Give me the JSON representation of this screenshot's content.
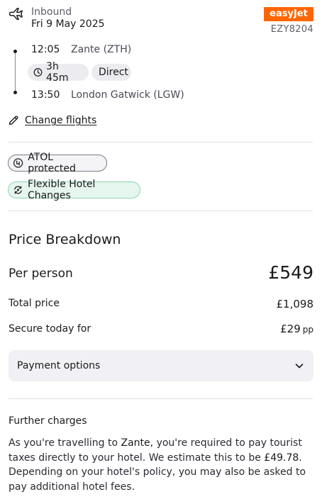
{
  "flight": {
    "direction": "Inbound",
    "date": "Fri 9 May 2025",
    "airline": "easyJet",
    "flight_number": "EZY8204",
    "departure": {
      "time": "12:05",
      "airport": "Zante (ZTH)"
    },
    "duration": "3h 45m",
    "stops": "Direct",
    "arrival": {
      "time": "13:50",
      "airport": "London Gatwick (LGW)"
    },
    "change_label": "Change flights"
  },
  "badges": {
    "atol": "ATOL protected",
    "flex": "Flexible Hotel Changes"
  },
  "price": {
    "title": "Price Breakdown",
    "per_person_label": "Per person",
    "per_person_value": "£549",
    "total_label": "Total price",
    "total_value": "£1,098",
    "secure_label": "Secure today for",
    "secure_value": "£29",
    "secure_unit": "pp",
    "payment_options_label": "Payment options"
  },
  "further": {
    "title": "Further charges",
    "text_1": "As you're travelling to ",
    "destination": "Zante",
    "text_2": ", you're required to pay tourist taxes directly to your hotel. We estimate this to be ",
    "amount": "£49.78",
    "text_3": ". Depending on your hotel's policy, you may also be asked to pay additional hotel fees."
  },
  "colors": {
    "airline_brand": "#ff6600",
    "flex_badge_bg": "#e5f6ee",
    "flex_badge_border": "#8fd3b6",
    "payment_box_bg": "#f1f0f4"
  },
  "icons": {
    "plane": "plane-icon",
    "clock": "clock-icon",
    "edit": "pencil-icon",
    "atol": "atol-icon",
    "flex": "flexible-icon",
    "chevron": "chevron-down-icon"
  }
}
